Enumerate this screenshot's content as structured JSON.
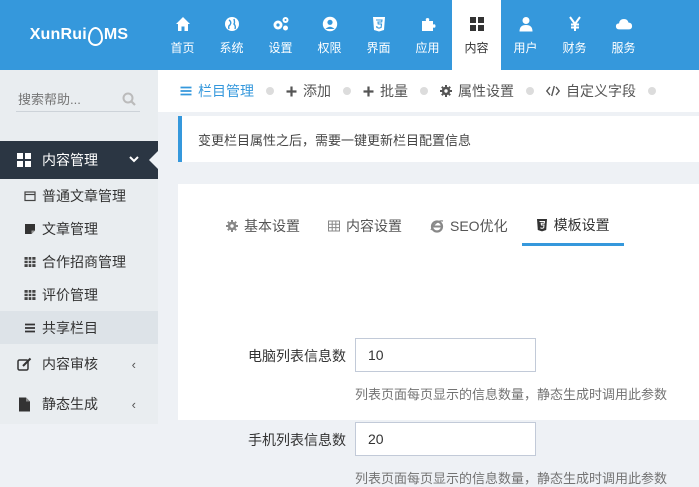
{
  "logo": {
    "left": "XunRui",
    "right": "MS"
  },
  "nav": [
    {
      "label": "首页",
      "icon": "home-icon"
    },
    {
      "label": "系统",
      "icon": "globe-icon"
    },
    {
      "label": "设置",
      "icon": "cogs-icon"
    },
    {
      "label": "权限",
      "icon": "user-circle-icon"
    },
    {
      "label": "界面",
      "icon": "html5-icon"
    },
    {
      "label": "应用",
      "icon": "puzzle-icon"
    },
    {
      "label": "内容",
      "icon": "th-large-icon",
      "active": true
    },
    {
      "label": "用户",
      "icon": "user-icon"
    },
    {
      "label": "财务",
      "icon": "yen-icon"
    },
    {
      "label": "服务",
      "icon": "cloud-icon"
    }
  ],
  "sidebar": {
    "search_placeholder": "搜索帮助...",
    "section_title": "内容管理",
    "items": [
      {
        "label": "普通文章管理",
        "icon": "folder-icon"
      },
      {
        "label": "文章管理",
        "icon": "sticky-note-icon"
      },
      {
        "label": "合作招商管理",
        "icon": "table-icon"
      },
      {
        "label": "评价管理",
        "icon": "table-icon"
      },
      {
        "label": "共享栏目",
        "icon": "bars-icon",
        "current": true
      }
    ],
    "groups": [
      {
        "label": "内容审核",
        "icon": "edit-icon",
        "chevron": "‹"
      },
      {
        "label": "静态生成",
        "icon": "file-icon",
        "chevron": "‹"
      }
    ]
  },
  "breadcrumb": [
    {
      "label": "栏目管理",
      "icon": "bars-icon",
      "active": true
    },
    {
      "label": "添加",
      "icon": "plus-icon"
    },
    {
      "label": "批量",
      "icon": "plus-icon"
    },
    {
      "label": "属性设置",
      "icon": "cog-icon"
    },
    {
      "label": "自定义字段",
      "icon": "code-icon"
    }
  ],
  "notice": "变更栏目属性之后，需要一键更新栏目配置信息",
  "tabs": [
    {
      "label": "基本设置",
      "icon": "cog-icon"
    },
    {
      "label": "内容设置",
      "icon": "table-icon"
    },
    {
      "label": "SEO优化",
      "icon": "ie-icon"
    },
    {
      "label": "模板设置",
      "icon": "html5-icon",
      "active": true
    }
  ],
  "form": {
    "pc_label": "电脑列表信息数",
    "pc_value": "10",
    "pc_help": "列表页面每页显示的信息数量，静态生成时调用此参数",
    "mobile_label": "手机列表信息数",
    "mobile_value": "20",
    "mobile_help": "列表页面每页显示的信息数量，静态生成时调用此参数"
  },
  "colors": {
    "accent": "#3598dc",
    "sidebar_dark": "#2b3643",
    "sidebar_light": "#e9edf0"
  }
}
